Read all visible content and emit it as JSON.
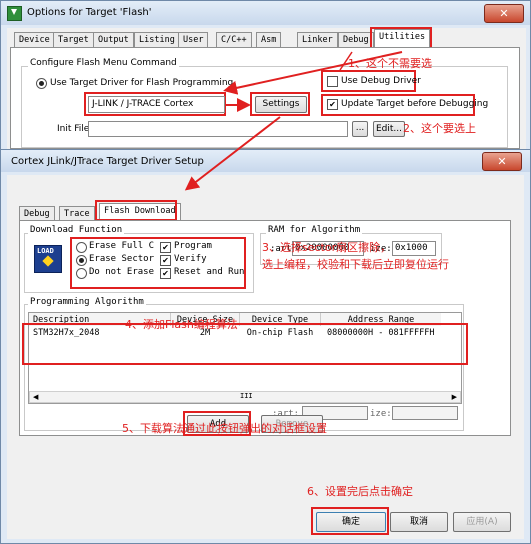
{
  "outer": {
    "title": "Options for Target 'Flash'",
    "tabs": [
      "Device",
      "Target",
      "Output",
      "Listing",
      "User",
      "C/C++",
      "Asm",
      "Linker",
      "Debug",
      "Utilities"
    ],
    "group_title": "Configure Flash Menu Command",
    "use_target_driver": "Use Target Driver for Flash Programming",
    "driver": "J-LINK / J-TRACE Cortex",
    "settings": "Settings",
    "use_debug_driver": "Use Debug Driver",
    "update_target": "Update Target before Debugging",
    "init_file_label": "Init File:",
    "browse": "...",
    "edit": "Edit..."
  },
  "inner": {
    "title": "Cortex JLink/JTrace Target Driver Setup",
    "tabs": [
      "Debug",
      "Trace",
      "Flash Download"
    ],
    "download_function": {
      "title": "Download Function",
      "load_icon": "LOAD",
      "erase_full": "Erase Full C",
      "erase_sector": "Erase Sector",
      "no_erase": "Do not Erase",
      "program": "Program",
      "verify": "Verify",
      "reset_run": "Reset and Run"
    },
    "ram": {
      "title": "RAM for Algorithm",
      "start_label": ":art:",
      "start_value": "0x20000000",
      "size_label": "ize:",
      "size_value": "0x1000"
    },
    "algorithm": {
      "title": "Programming Algorithm",
      "headers": [
        "Description",
        "Device Size",
        "Device Type",
        "Address Range"
      ],
      "row": [
        "STM32H7x_2048",
        "2M",
        "On-chip Flash",
        "08000000H - 081FFFFFH"
      ],
      "start_label": ":art:",
      "size_label": "ize:",
      "scroll_mark": "III"
    },
    "add": "Add",
    "remove": "Remove",
    "ok": "确定",
    "cancel": "取消",
    "apply": "应用(A)"
  },
  "annotations": {
    "a1": "1、这个不需要选",
    "a2": "2、这个要选上",
    "a3_line1": "3、选择sector扇区擦除，",
    "a3_line2": "选上编程，校验和下载后立即复位运行",
    "a4": "4、添加Flash编程算法",
    "a5": "5、下载算法通过此按钮弹出的对话框设置",
    "a6": "6、设置完后点击确定"
  },
  "colors": {
    "annotation": "#e02020"
  }
}
